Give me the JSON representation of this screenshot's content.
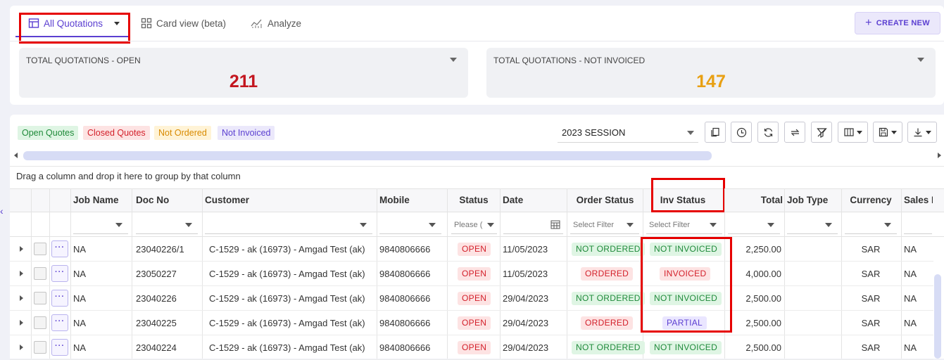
{
  "tabs": [
    {
      "label": "All Quotations",
      "icon": "table-icon",
      "active": true
    },
    {
      "label": "Card view (beta)",
      "icon": "grid-icon"
    },
    {
      "label": "Analyze",
      "icon": "chart-icon"
    }
  ],
  "create_button": {
    "label": "CREATE NEW",
    "icon": "plus-icon"
  },
  "kpis": [
    {
      "title": "TOTAL QUOTATIONS - OPEN",
      "value": "211",
      "color": "#c3161f"
    },
    {
      "title": "TOTAL QUOTATIONS - NOT INVOICED",
      "value": "147",
      "color": "#e8a013"
    }
  ],
  "filter_chips": [
    {
      "label": "Open Quotes",
      "bg": "#dff5e4",
      "color": "#1f8a3a"
    },
    {
      "label": "Closed Quotes",
      "bg": "#fde3e3",
      "color": "#d31f2a"
    },
    {
      "label": "Not Ordered",
      "bg": "#fff3d6",
      "color": "#d88a00"
    },
    {
      "label": "Not Invoiced",
      "bg": "#ebe8fb",
      "color": "#5b3fd1"
    }
  ],
  "session_select": {
    "value": "2023 SESSION"
  },
  "toolbar_icons": [
    "copy-icon",
    "clock-icon",
    "refresh-icon",
    "swap-icon",
    "clear-filter-icon",
    "columns-icon",
    "save-icon",
    "download-icon"
  ],
  "group_panel_text": "Drag a column and drop it here to group by that column",
  "columns": [
    "Job Name",
    "Doc No",
    "Customer",
    "Mobile",
    "Status",
    "Date",
    "Order Status",
    "Inv Status",
    "Total",
    "Job Type",
    "Currency",
    "Sales F"
  ],
  "filters": {
    "status_placeholder": "Please (",
    "order_status_placeholder": "Select Filter",
    "inv_status_placeholder": "Select Filter"
  },
  "rows": [
    {
      "job_name": "NA",
      "doc_no": "23040226/1",
      "customer": "C-1529 - ak (16973) - Amgad Test (ak)",
      "mobile": "9840806666",
      "status": "OPEN",
      "date": "11/05/2023",
      "order_status": "NOT ORDERED",
      "inv_status": "NOT INVOICED",
      "total": "2,250.00",
      "job_type": "",
      "currency": "SAR",
      "sales": "NA"
    },
    {
      "job_name": "NA",
      "doc_no": "23050227",
      "customer": "C-1529 - ak (16973) - Amgad Test (ak)",
      "mobile": "9840806666",
      "status": "OPEN",
      "date": "11/05/2023",
      "order_status": "ORDERED",
      "inv_status": "INVOICED",
      "total": "4,000.00",
      "job_type": "",
      "currency": "SAR",
      "sales": "NA"
    },
    {
      "job_name": "NA",
      "doc_no": "23040226",
      "customer": "C-1529 - ak (16973) - Amgad Test (ak)",
      "mobile": "9840806666",
      "status": "OPEN",
      "date": "29/04/2023",
      "order_status": "NOT ORDERED",
      "inv_status": "NOT INVOICED",
      "total": "2,500.00",
      "job_type": "",
      "currency": "SAR",
      "sales": "NA"
    },
    {
      "job_name": "NA",
      "doc_no": "23040225",
      "customer": "C-1529 - ak (16973) - Amgad Test (ak)",
      "mobile": "9840806666",
      "status": "OPEN",
      "date": "29/04/2023",
      "order_status": "ORDERED",
      "inv_status": "PARTIAL",
      "total": "2,500.00",
      "job_type": "",
      "currency": "SAR",
      "sales": "NA"
    },
    {
      "job_name": "NA",
      "doc_no": "23040224",
      "customer": "C-1529 - ak (16973) - Amgad Test (ak)",
      "mobile": "9840806666",
      "status": "OPEN",
      "date": "29/04/2023",
      "order_status": "NOT ORDERED",
      "inv_status": "NOT INVOICED",
      "total": "2,500.00",
      "job_type": "",
      "currency": "SAR",
      "sales": "NA"
    }
  ],
  "badge_colors": {
    "OPEN": "red",
    "ORDERED": "red",
    "INVOICED": "red",
    "NOT ORDERED": "green",
    "NOT INVOICED": "green",
    "PARTIAL": "purple"
  }
}
